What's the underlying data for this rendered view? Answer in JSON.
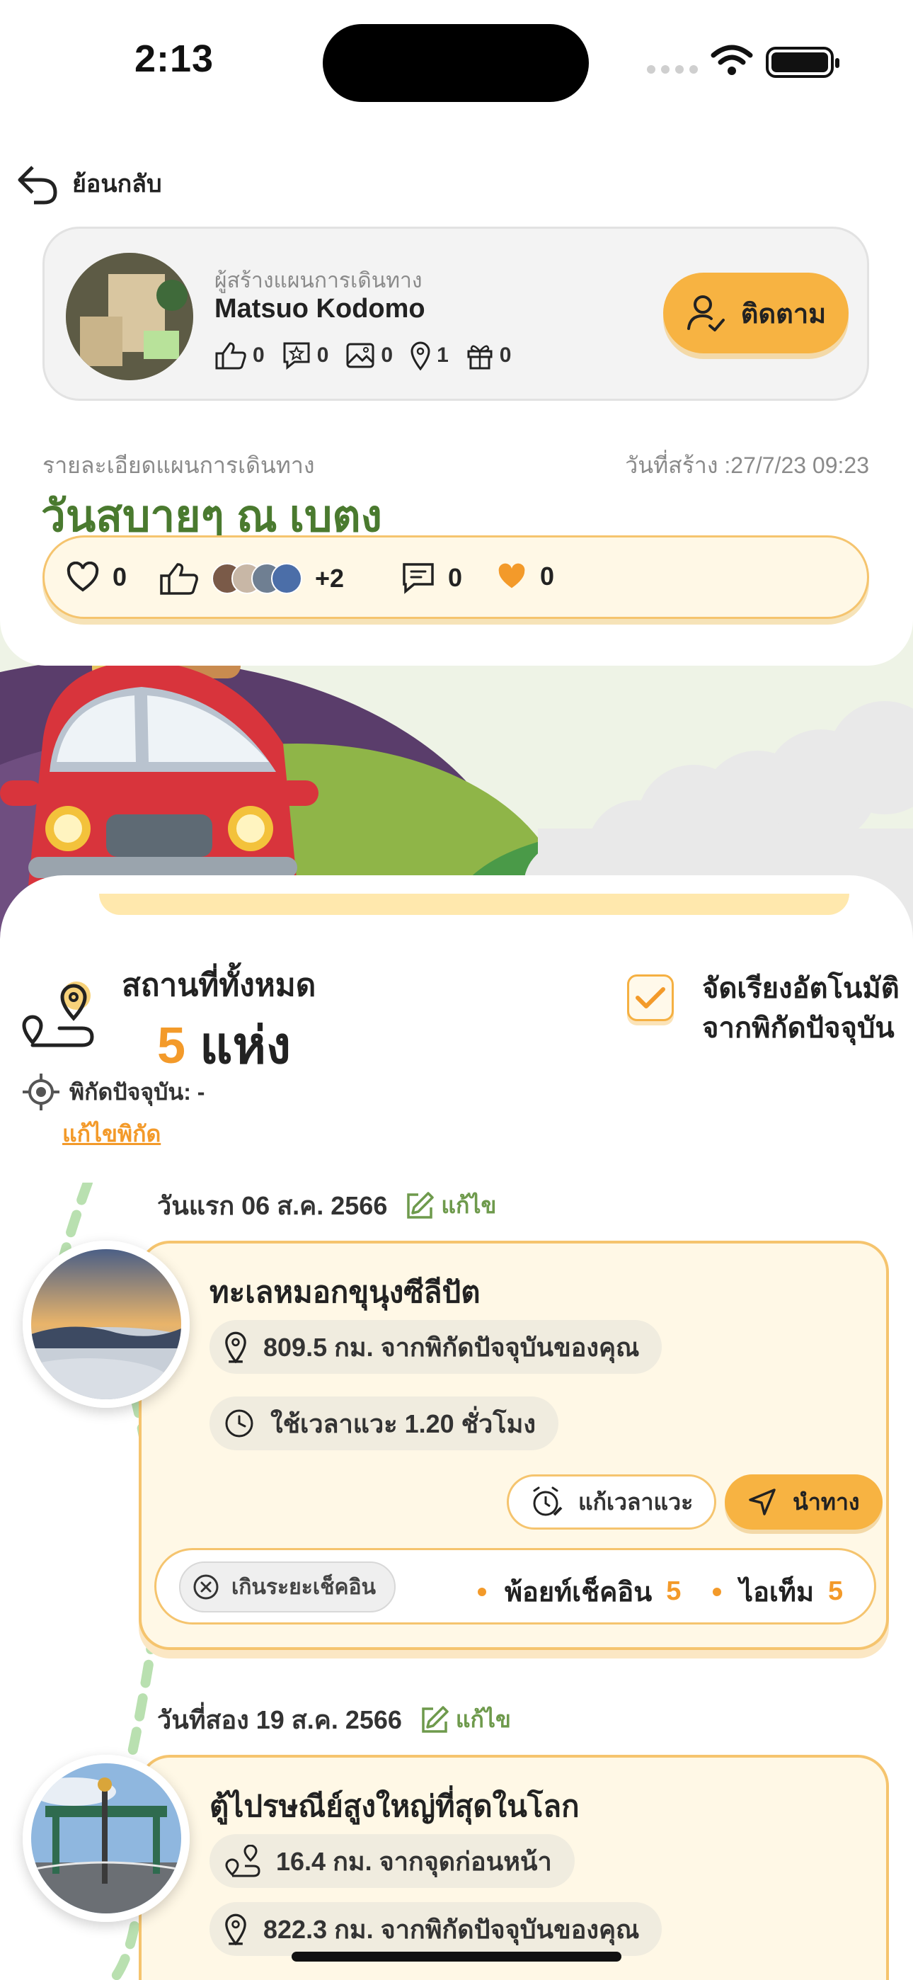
{
  "status": {
    "time": "2:13"
  },
  "nav": {
    "back_label": "ย้อนกลับ"
  },
  "creator": {
    "caption": "ผู้สร้างแผนการเดินทาง",
    "name": "Matsuo Kodomo",
    "follow_label": "ติดตาม",
    "stats": {
      "likes": "0",
      "reviews": "0",
      "photos": "0",
      "places": "1",
      "gifts": "0"
    }
  },
  "plan": {
    "caption": "รายละเอียดแผนการเดินทาง",
    "created": "วันที่สร้าง :27/7/23 09:23",
    "title": "วันสบายๆ ณ เบตง",
    "reactions": {
      "hearts": "0",
      "likers_more": "+2",
      "comments": "0",
      "favorites": "0"
    }
  },
  "places": {
    "title": "สถานที่ทั้งหมด",
    "count": "5",
    "unit": "แห่ง",
    "auto_sort_line1": "จัดเรียงอัตโนมัติ",
    "auto_sort_line2": "จากพิกัดปัจจุบัน",
    "current_location": "พิกัดปัจจุบัน: -",
    "edit_location": "แก้ไขพิกัด"
  },
  "days": [
    {
      "label": "วันแรก 06 ส.ค. 2566",
      "edit_label": "แก้ไข",
      "place": {
        "name": "ทะเลหมอกขุนุงซีลีปัต",
        "distance_current": "809.5 กม. จากพิกัดปัจจุบันของคุณ",
        "duration": "ใช้เวลาแวะ 1.20 ชั่วโมง",
        "edit_time_label": "แก้เวลาแวะ",
        "navigate_label": "นำทาง",
        "late_label": "เกินระยะเช็คอิน",
        "checkin_points_label": "พ้อยท์เช็คอิน",
        "checkin_points": "5",
        "items_label": "ไอเท็ม",
        "items": "5"
      }
    },
    {
      "label": "วันที่สอง 19 ส.ค. 2566",
      "edit_label": "แก้ไข",
      "place": {
        "name": "ตู้ไปรษณีย์สูงใหญ่ที่สุดในโลก",
        "distance_previous": "16.4 กม. จากจุดก่อนหน้า",
        "distance_current": "822.3 กม. จากพิกัดปัจจุบันของคุณ"
      }
    }
  ],
  "colors": {
    "accent": "#f7b342",
    "orange": "#f39a2a",
    "green_title": "#4a7a2f",
    "card_bg": "#fff8e6"
  }
}
